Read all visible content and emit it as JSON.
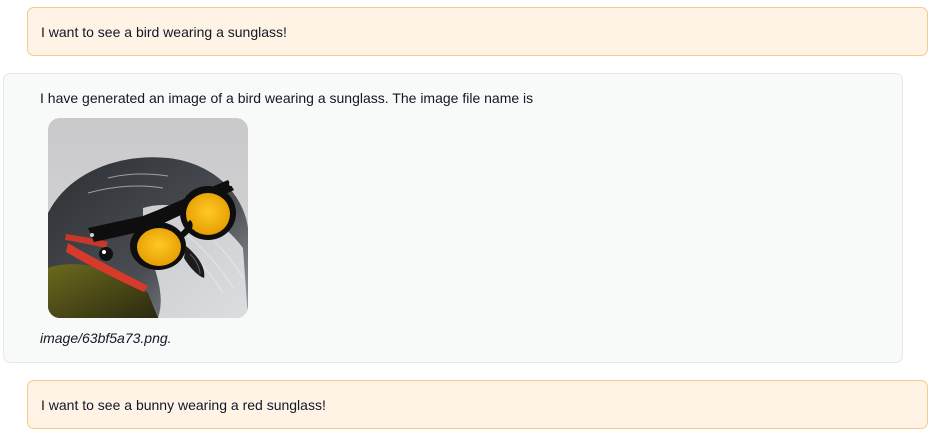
{
  "conversation": {
    "messages": [
      {
        "role": "user",
        "text": "I want to see a bird wearing a sunglass!"
      },
      {
        "role": "assistant",
        "text": "I have generated an image of a bird wearing a sunglass. The image file name is",
        "filename": "image/63bf5a73.png."
      },
      {
        "role": "user",
        "text": "I want to see a bunny wearing a red sunglass!"
      }
    ]
  },
  "colors": {
    "user_bubble_bg": "#fff3e6",
    "user_bubble_border": "#f8c98a",
    "assistant_bubble_bg": "#f8f9f9",
    "assistant_bubble_border": "#e5e7eb",
    "sunglass_lens": "#f5b50a"
  },
  "image_description_icon": "bird-with-sunglasses-image"
}
